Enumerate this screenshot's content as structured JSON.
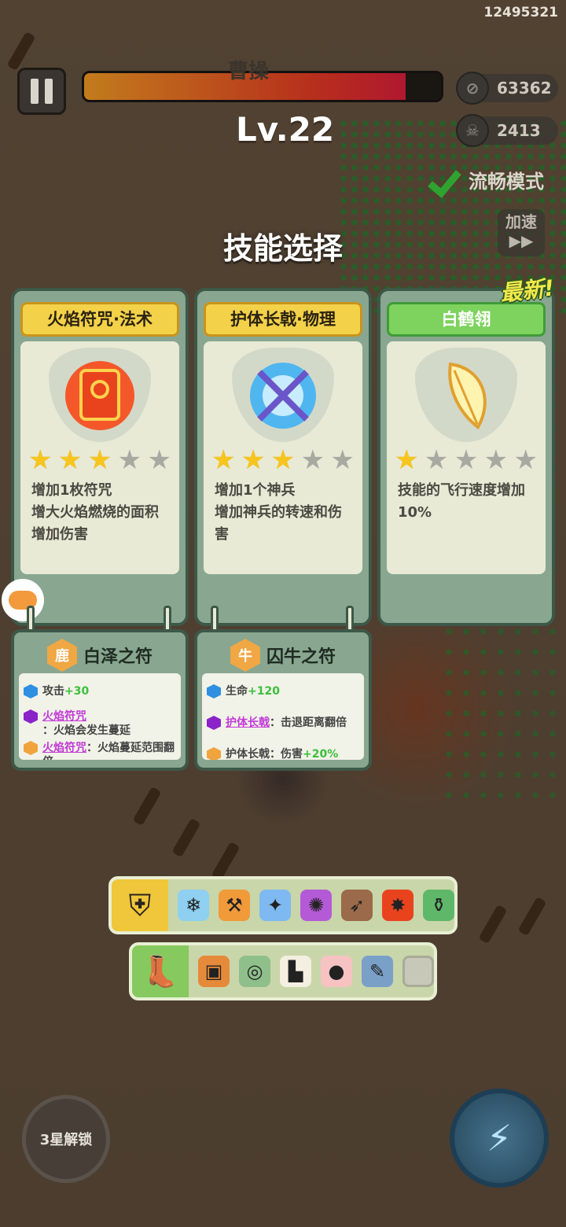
{
  "hud": {
    "player_id": "12495321",
    "boss_name": "曹操",
    "boss_hp_fraction": 0.9,
    "level": "Lv.22",
    "coins": "63362",
    "kills": "2413",
    "smooth_mode": "流畅模式",
    "speed_up": "加速"
  },
  "selection": {
    "title": "技能选择",
    "new_tag": "最新!",
    "cards": [
      {
        "name": "火焰符咒·法术",
        "stars": 3,
        "max_stars": 5,
        "lines": [
          "增加1枚符咒",
          "增大火焰燃烧的面积",
          "增加伤害"
        ],
        "icon": "fire-scroll-icon"
      },
      {
        "name": "护体长戟·物理",
        "stars": 3,
        "max_stars": 5,
        "lines": [
          "增加1个神兵",
          "增加神兵的转速和伤",
          "害"
        ],
        "icon": "spinning-halberd-icon"
      },
      {
        "name": "白鹤翎",
        "stars": 1,
        "max_stars": 5,
        "lines": [
          "技能的飞行速度增加",
          "10%"
        ],
        "icon": "white-crane-feather-icon"
      }
    ]
  },
  "talismans": [
    {
      "name": "白泽之符",
      "stat_label": "攻击",
      "stat_value": "+30",
      "effect1_link": "火焰符咒",
      "effect1_text": "：火焰会发生蔓延",
      "effect2_link": "火焰符咒",
      "effect2_text": "：火焰蔓延范围翻倍"
    },
    {
      "name": "囚牛之符",
      "stat_label": "生命",
      "stat_value": "+120",
      "effect1_link": "护体长戟",
      "effect1_text": "：击退距离翻倍",
      "effect2_text": "护体长戟：伤害",
      "effect2_value": "+20%"
    }
  ],
  "weapon_bar": {
    "category_icon": "shield-sword-icon",
    "slots": [
      "ice-dragon-icon",
      "fire-hammer-icon",
      "spinning-halberd-icon",
      "purple-flame-icon",
      "crossbow-icon",
      "fire-scroll-icon",
      "green-cauldron-icon"
    ]
  },
  "passive_bar": {
    "category_icon": "winged-boot-icon",
    "slots": [
      "treasure-chest-icon",
      "jade-pendant-icon",
      "white-boot-icon",
      "peach-icon",
      "scroll-bundle-icon",
      "empty-slot"
    ]
  },
  "buttons": {
    "locked_skill": "3星解锁",
    "ultimate_icon": "lightning-icon"
  },
  "colors": {
    "star_on": "#f7c51e",
    "star_off": "#a8aaa2",
    "card_label_gold": "#f3d24a",
    "card_label_new": "#7ed35e",
    "stat_plus": "#3cbf3c",
    "link_purple": "#c13ad6"
  }
}
